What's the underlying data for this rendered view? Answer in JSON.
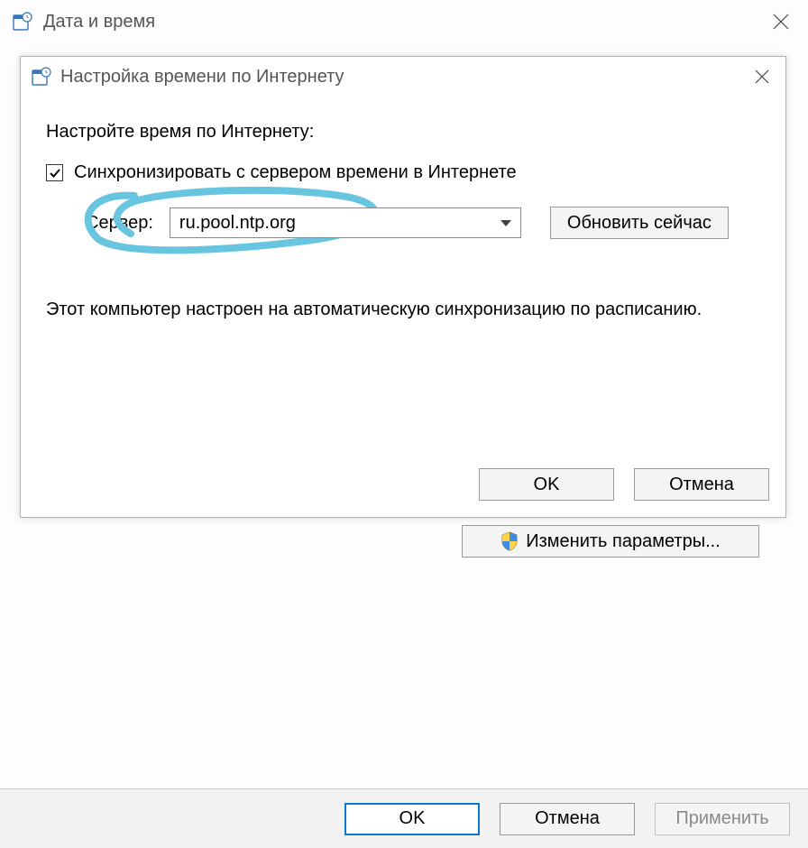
{
  "outer": {
    "title": "Дата и время",
    "change_settings": "Изменить параметры...",
    "buttons": {
      "ok": "OK",
      "cancel": "Отмена",
      "apply": "Применить"
    }
  },
  "dialog": {
    "title": "Настройка времени по Интернету",
    "heading": "Настройте время по Интернету:",
    "checkbox_label": "Синхронизировать с сервером времени в Интернете",
    "checkbox_checked": true,
    "server_label": "Сервер:",
    "server_value": "ru.pool.ntp.org",
    "update_button": "Обновить сейчас",
    "status": "Этот компьютер настроен на автоматическую синхронизацию по расписанию.",
    "buttons": {
      "ok": "OK",
      "cancel": "Отмена"
    }
  },
  "annotation": {
    "color": "#67c5e0"
  }
}
